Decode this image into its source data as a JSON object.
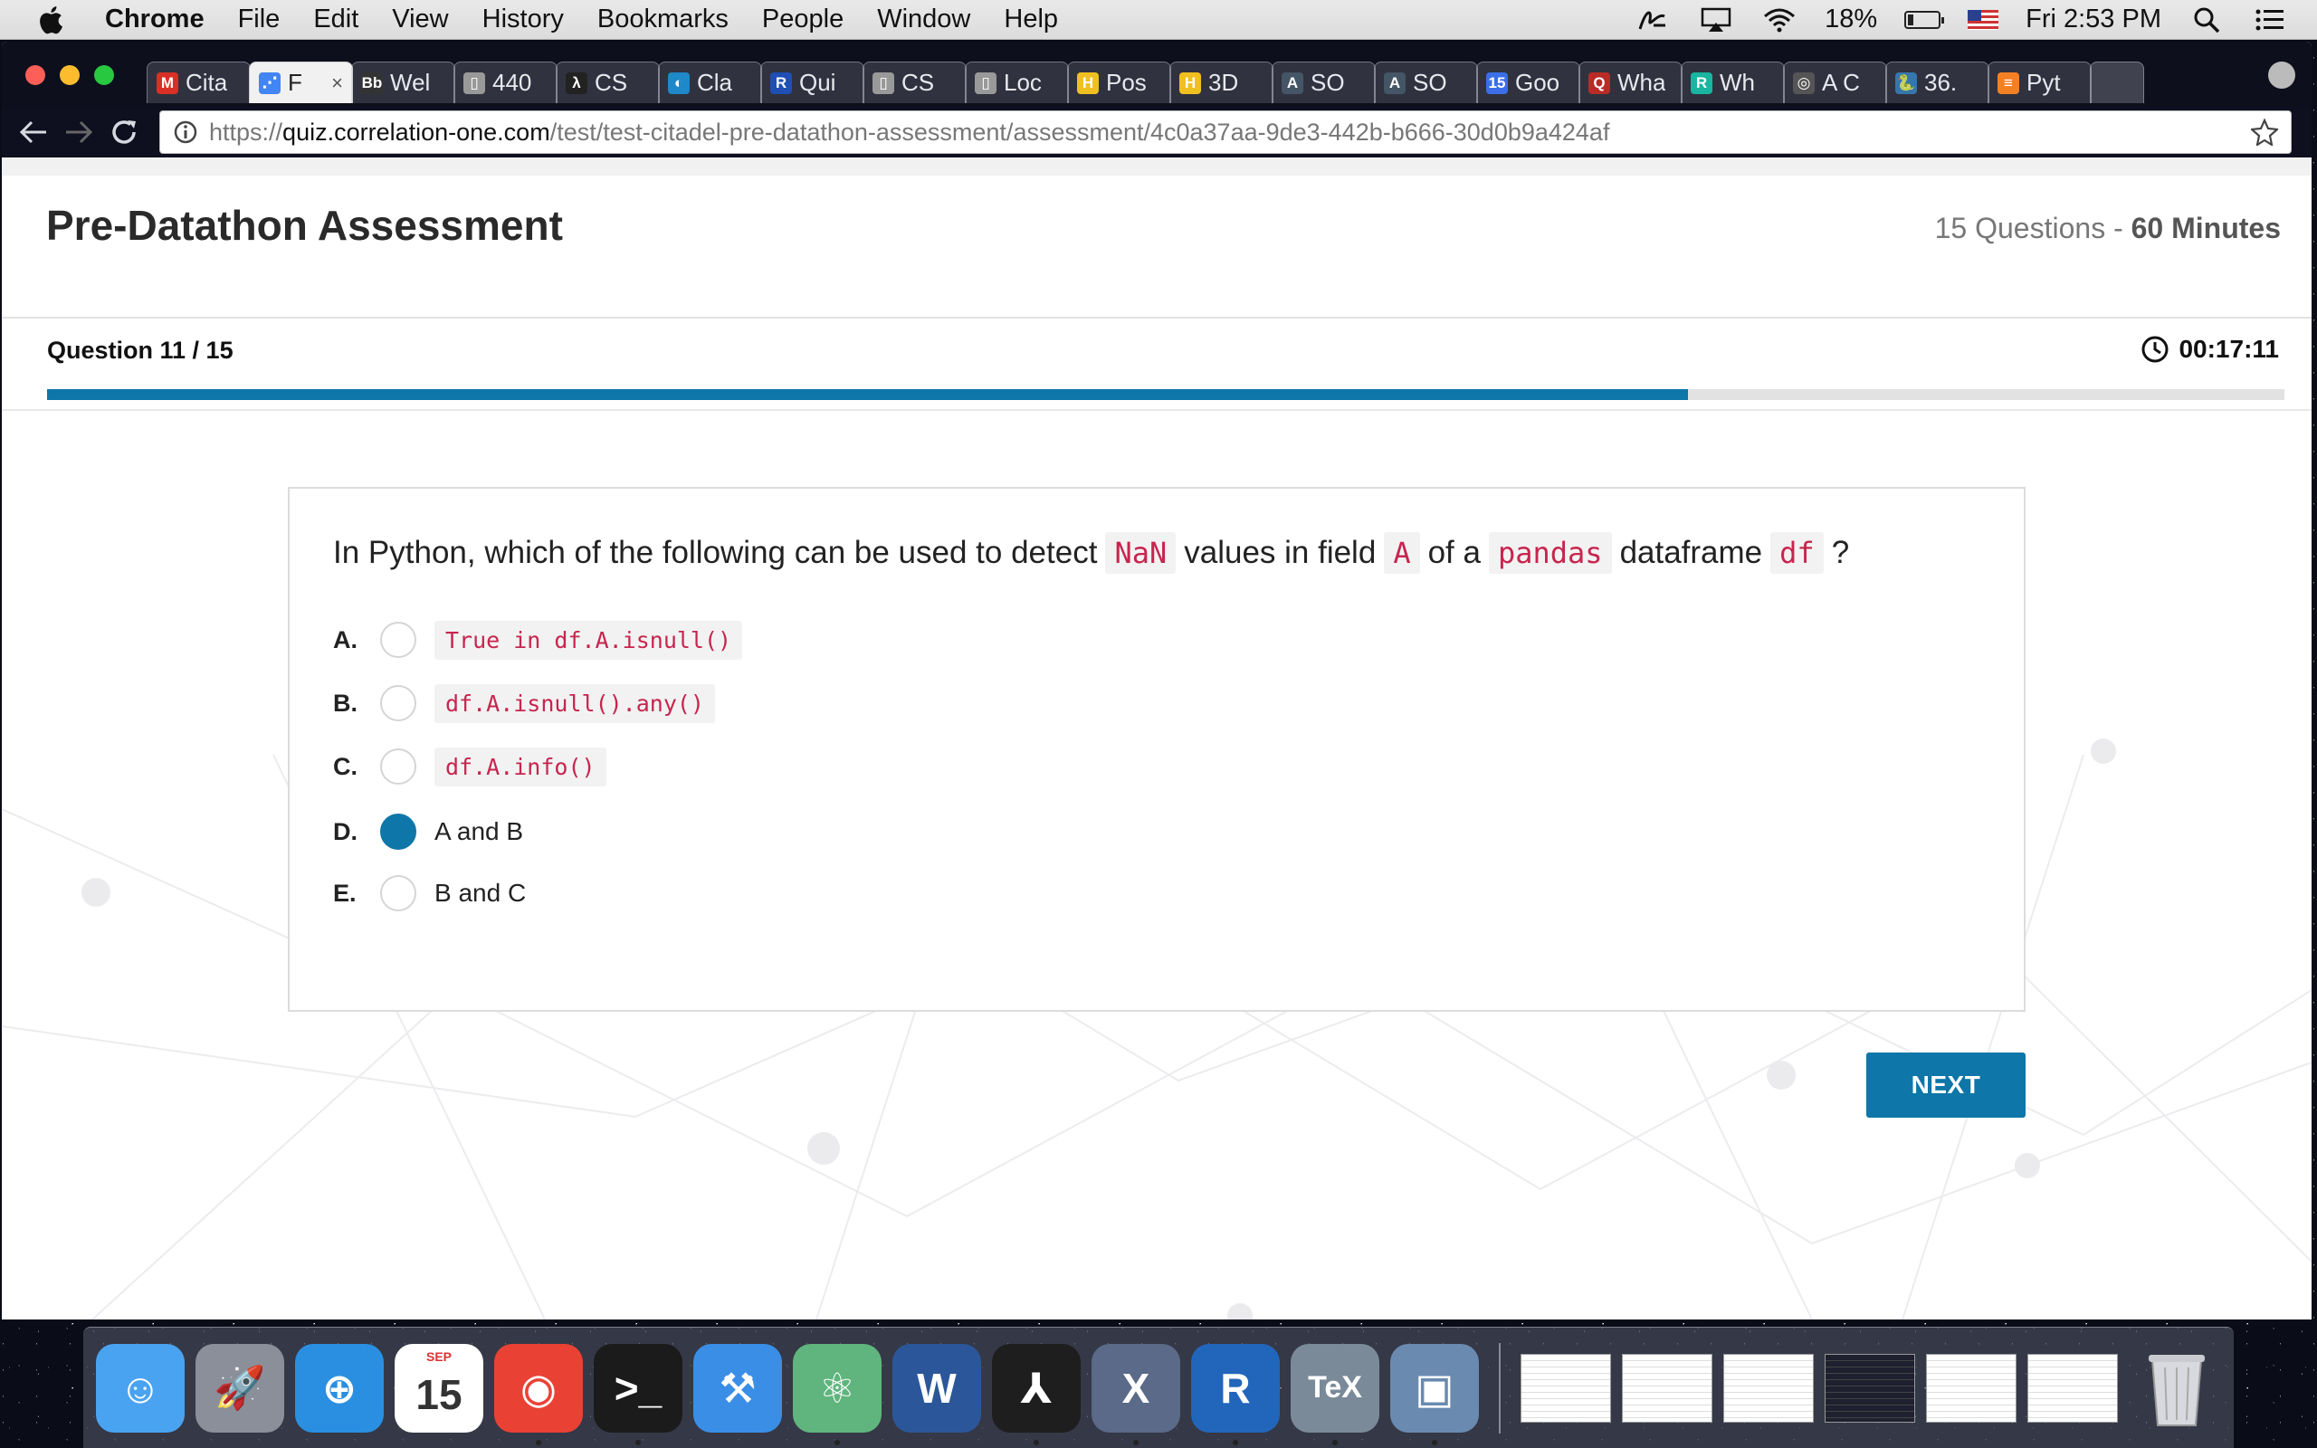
{
  "menubar": {
    "app_name": "Chrome",
    "items": [
      "File",
      "Edit",
      "View",
      "History",
      "Bookmarks",
      "People",
      "Window",
      "Help"
    ],
    "battery": "18%",
    "clock": "Fri 2:53 PM"
  },
  "tabs": [
    {
      "title": "Cita",
      "icon": "gmail-icon",
      "color": "#d93025",
      "glyph": "M"
    },
    {
      "title": "F",
      "icon": "dots-icon",
      "color": "#4285f4",
      "glyph": "⋰",
      "active": true
    },
    {
      "title": "Wel",
      "icon": "blackboard-icon",
      "color": "#333333",
      "glyph": "Bb"
    },
    {
      "title": "440",
      "icon": "document-icon",
      "color": "#999999",
      "glyph": "▯"
    },
    {
      "title": "CS",
      "icon": "lambda-icon",
      "color": "#222222",
      "glyph": "λ"
    },
    {
      "title": "Cla",
      "icon": "circle-logo-icon",
      "color": "#1e88c8",
      "glyph": "◐"
    },
    {
      "title": "Qui",
      "icon": "r-logo-icon",
      "color": "#1f4fb5",
      "glyph": "R"
    },
    {
      "title": "CS",
      "icon": "document-icon",
      "color": "#999999",
      "glyph": "▯"
    },
    {
      "title": "Loc",
      "icon": "document-icon",
      "color": "#999999",
      "glyph": "▯"
    },
    {
      "title": "Pos",
      "icon": "h-logo-icon",
      "color": "#f0c020",
      "glyph": "H"
    },
    {
      "title": "3D",
      "icon": "h-logo-icon",
      "color": "#f0c020",
      "glyph": "H"
    },
    {
      "title": "SO",
      "icon": "so-logo-icon",
      "color": "#445566",
      "glyph": "A"
    },
    {
      "title": "SO",
      "icon": "so-logo-icon",
      "color": "#445566",
      "glyph": "A"
    },
    {
      "title": "Goo",
      "icon": "calendar-icon",
      "color": "#3b6ee8",
      "glyph": "15"
    },
    {
      "title": "Wha",
      "icon": "quora-icon",
      "color": "#b92b27",
      "glyph": "Q"
    },
    {
      "title": "Wh",
      "icon": "rg-logo-icon",
      "color": "#18b6a0",
      "glyph": "R"
    },
    {
      "title": "A C",
      "icon": "globe-icon",
      "color": "#555555",
      "glyph": "◎"
    },
    {
      "title": "36.",
      "icon": "python-icon",
      "color": "#3776ab",
      "glyph": "🐍"
    },
    {
      "title": "Pyt",
      "icon": "stack-icon",
      "color": "#f48024",
      "glyph": "≡"
    }
  ],
  "address_bar": {
    "scheme": "https://",
    "host": "quiz.correlation-one.com",
    "path": "/test/test-citadel-pre-datathon-assessment/assessment/4c0a37aa-9de3-442b-b666-30d0b9a424af"
  },
  "page": {
    "title": "Pre-Datathon Assessment",
    "question_total_text": "15 Questions -",
    "duration_text": "60 Minutes",
    "question_counter": "Question 11 / 15",
    "timer": "00:17:11",
    "progress_fraction": 0.7333,
    "question": {
      "parts": [
        {
          "text": "In Python, which of the following can be used to detect",
          "code": false
        },
        {
          "text": "NaN",
          "code": true
        },
        {
          "text": "values in field",
          "code": false
        },
        {
          "text": "A",
          "code": true
        },
        {
          "text": "of a",
          "code": false
        },
        {
          "text": "pandas",
          "code": true
        },
        {
          "text": "dataframe",
          "code": false
        },
        {
          "text": "df",
          "code": true
        },
        {
          "text": "?",
          "code": false
        }
      ]
    },
    "options": [
      {
        "letter": "A.",
        "text": "True in df.A.isnull()",
        "code": true,
        "selected": false
      },
      {
        "letter": "B.",
        "text": "df.A.isnull().any()",
        "code": true,
        "selected": false
      },
      {
        "letter": "C.",
        "text": "df.A.info()",
        "code": true,
        "selected": false
      },
      {
        "letter": "D.",
        "text": "A and B",
        "code": false,
        "selected": true
      },
      {
        "letter": "E.",
        "text": "B and C",
        "code": false,
        "selected": false
      }
    ],
    "next_label": "NEXT",
    "accent_color": "#0e76a8"
  },
  "dock": {
    "apps": [
      {
        "name": "finder-icon",
        "color": "#4aa3f0",
        "glyph": "☺"
      },
      {
        "name": "launchpad-icon",
        "color": "#8a8f99",
        "glyph": "🚀"
      },
      {
        "name": "safari-icon",
        "color": "#2a8fe0",
        "glyph": "⊕"
      },
      {
        "name": "calendar-icon",
        "color": "#ffffff",
        "glyph": "15",
        "label": "SEP"
      },
      {
        "name": "chrome-icon",
        "color": "#e94235",
        "glyph": "◉"
      },
      {
        "name": "terminal-icon",
        "color": "#1b1b1b",
        "glyph": ">_"
      },
      {
        "name": "xcode-icon",
        "color": "#3a8ee6",
        "glyph": "⚒"
      },
      {
        "name": "atom-icon",
        "color": "#5fb57d",
        "glyph": "⚛"
      },
      {
        "name": "word-icon",
        "color": "#2b579a",
        "glyph": "W"
      },
      {
        "name": "acrobat-icon",
        "color": "#1e1e1e",
        "glyph": "⅄"
      },
      {
        "name": "x11-icon",
        "color": "#5a6a88",
        "glyph": "X"
      },
      {
        "name": "r-app-icon",
        "color": "#2266bb",
        "glyph": "R"
      },
      {
        "name": "tex-icon",
        "color": "#7a8a99",
        "glyph": "TeX"
      },
      {
        "name": "preview-icon",
        "color": "#6a8ab0",
        "glyph": "▣"
      }
    ],
    "windows": 6
  }
}
